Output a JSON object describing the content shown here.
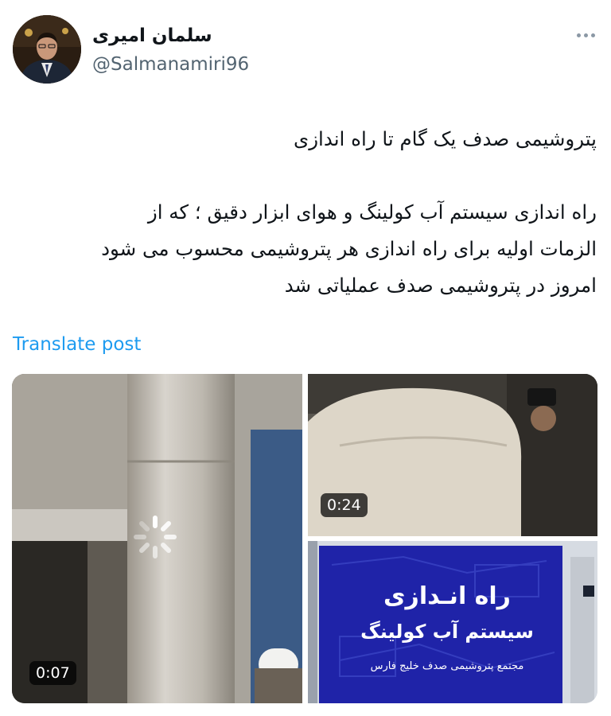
{
  "author": {
    "display_name": "سلمان امیری",
    "handle": "@Salmanamiri96",
    "avatar_icon": "profile-photo"
  },
  "tweet": {
    "headline": "پتروشیمی صدف یک گام تا راه اندازی",
    "body_lines": [
      "راه اندازی سیستم آب کولینگ و هوای ابزار دقیق ؛ که از",
      "الزمات اولیه برای راه اندازی هر پتروشیمی محسوب می شود",
      "امروز در پتروشیمی صدف عملیاتی شد"
    ]
  },
  "translate_label": "Translate post",
  "media": [
    {
      "duration": "0:07",
      "kind": "video"
    },
    {
      "duration": "0:24",
      "kind": "video"
    },
    {
      "kind": "image",
      "banner_title": "راه انـدازی",
      "banner_subtitle": "سیستم آب کولینگ",
      "banner_caption": "مجتمع پتروشیمی صدف خلیج فارس"
    }
  ],
  "colors": {
    "link": "#1d9bf0",
    "secondary_text": "#536471",
    "banner_blue": "#1f23a8"
  }
}
